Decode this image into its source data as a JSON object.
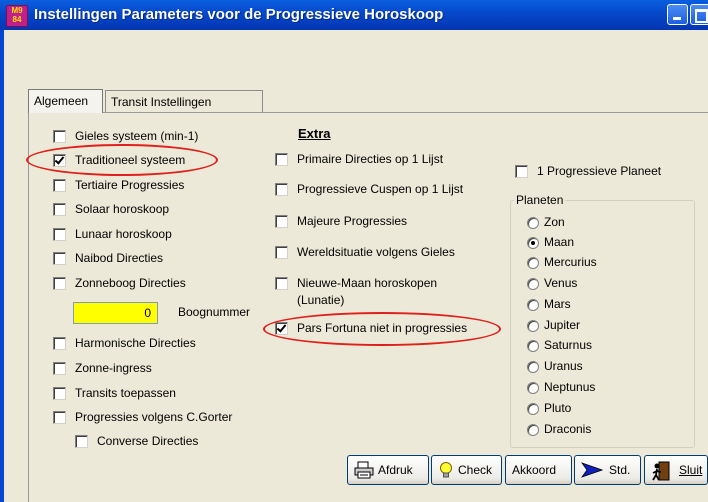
{
  "window": {
    "title": "Instellingen Parameters voor de Progressieve Horoskoop",
    "app_icon_text": "M9\n84"
  },
  "tabs": [
    {
      "label": "Algemeen"
    },
    {
      "label": "Transit Instellingen"
    }
  ],
  "left_options": [
    {
      "label": "Gieles systeem (min-1)",
      "checked": false
    },
    {
      "label": "Traditioneel systeem",
      "checked": true
    },
    {
      "label": "Tertiaire Progressies",
      "checked": false
    },
    {
      "label": "Solaar horoskoop",
      "checked": false
    },
    {
      "label": "Lunaar horoskoop",
      "checked": false
    },
    {
      "label": "Naibod Directies",
      "checked": false
    },
    {
      "label": "Zonneboog Directies",
      "checked": false
    },
    {
      "label": "Harmonische Directies",
      "checked": false
    },
    {
      "label": "Zonne-ingress",
      "checked": false
    },
    {
      "label": "Transits toepassen",
      "checked": false
    },
    {
      "label": "Progressies volgens C.Gorter",
      "checked": false
    },
    {
      "label": "Converse Directies",
      "checked": false
    }
  ],
  "boognummer": {
    "value": "0",
    "label": "Boognummer"
  },
  "extra": {
    "heading": "Extra",
    "options": [
      {
        "label": "Primaire Directies op 1 Lijst",
        "checked": false
      },
      {
        "label": "Progressieve Cuspen op 1 Lijst",
        "checked": false
      },
      {
        "label": "Majeure Progressies",
        "checked": false
      },
      {
        "label": "Wereldsituatie volgens Gieles",
        "checked": false
      },
      {
        "label": "Nieuwe-Maan horoskopen",
        "checked": false
      },
      {
        "label": "Pars Fortuna niet in progressies",
        "checked": true
      }
    ],
    "lunatie_label": "(Lunatie)"
  },
  "progressive_planet": {
    "label": "1 Progressieve Planeet",
    "checked": false
  },
  "planeten": {
    "title": "Planeten",
    "selected": "Maan",
    "options": [
      "Zon",
      "Maan",
      "Mercurius",
      "Venus",
      "Mars",
      "Jupiter",
      "Saturnus",
      "Uranus",
      "Neptunus",
      "Pluto",
      "Draconis"
    ]
  },
  "buttons": {
    "afdruk": "Afdruk",
    "check": "Check",
    "akkoord": "Akkoord",
    "std": "Std.",
    "sluit": "Sluit"
  },
  "icons": {
    "printer": "printer-icon",
    "bulb": "lightbulb-icon",
    "arrow": "arrow-icon",
    "exit": "exit-icon"
  },
  "colors": {
    "title_bar": "#0547c9",
    "highlight_input": "#ffff00",
    "annotation": "#e0201a"
  }
}
